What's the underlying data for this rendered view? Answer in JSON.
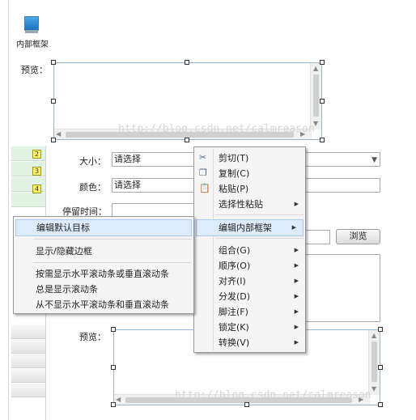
{
  "widget": {
    "label": "内部框架",
    "icon": "inline-frame-icon"
  },
  "top_preview": {
    "label": "预览："
  },
  "badges": [
    "2",
    "3",
    "4"
  ],
  "form": {
    "size_label": "大小：",
    "size_value": "请选择",
    "color_label": "颜色：",
    "color_value": "请选择",
    "dwell_label": "停留时间：",
    "browse_label": "浏览",
    "preview_label": "预览："
  },
  "watermark": "http://blog.csdn.net/calmreason",
  "context_menu": {
    "cut": "剪切(T)",
    "copy": "复制(C)",
    "paste": "粘贴(P)",
    "paste_special": "选择性粘贴",
    "edit_inline_frame": "编辑内部框架",
    "group": "组合(G)",
    "order": "顺序(O)",
    "align": "对齐(I)",
    "distribute": "分发(D)",
    "footnote": "脚注(F)",
    "lock": "锁定(K)",
    "convert": "转换(V)"
  },
  "submenu": {
    "edit_default_target": "编辑默认目标",
    "toggle_border": "显示/隐藏边框",
    "scroll_as_needed": "按需显示水平滚动条或垂直滚动条",
    "always_scroll": "总是显示滚动条",
    "never_scroll": "从不显示水平滚动条和垂直滚动条"
  },
  "colors": {
    "highlight": "#ddecfb",
    "badge": "#fff36a",
    "frame_border": "#9ab7d6"
  }
}
